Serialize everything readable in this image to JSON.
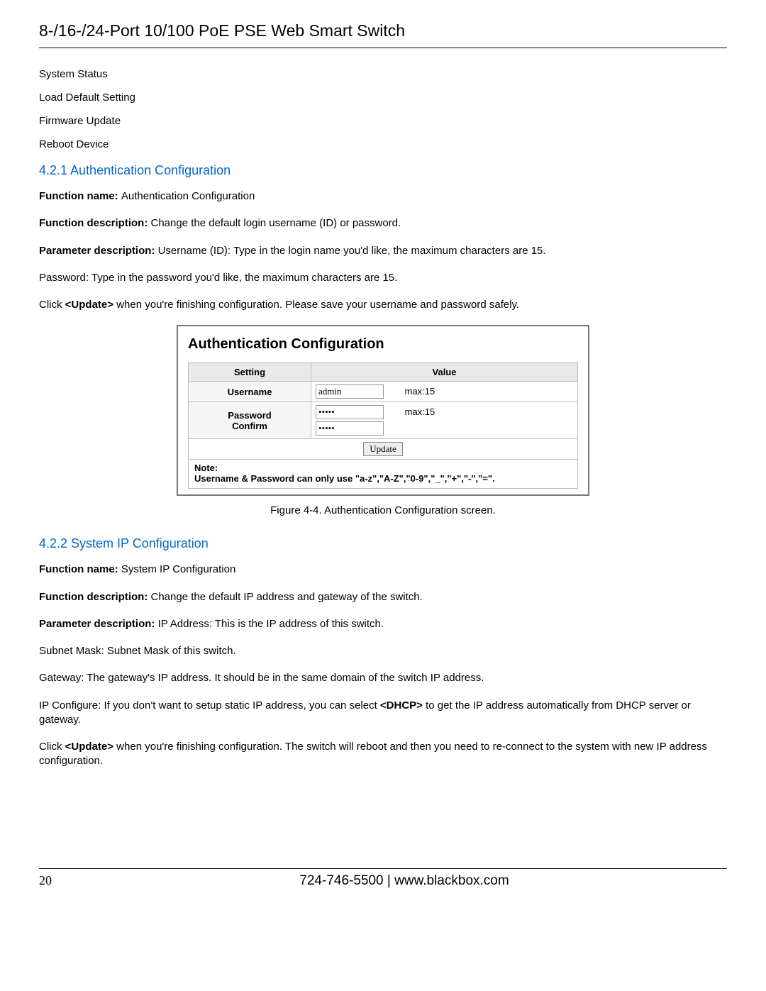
{
  "header": {
    "title": "8-/16-/24-Port 10/100 PoE PSE Web Smart Switch"
  },
  "menu_items": [
    "System Status",
    "Load Default Setting",
    "Firmware Update",
    "Reboot Device"
  ],
  "section1": {
    "heading": "4.2.1 Authentication Configuration",
    "fn_name_label": "Function name: ",
    "fn_name_value": "Authentication Configuration",
    "fn_desc_label": "Function description: ",
    "fn_desc_value": "Change the default login username (ID) or password.",
    "param_label": "Parameter description: ",
    "param_value": "Username (ID): Type in the login name you'd like, the maximum characters are 15.",
    "password_line": "Password: Type in the password you'd like, the maximum characters are 15.",
    "click_prefix": "Click ",
    "update_tag": "<Update>",
    "click_suffix": " when you're finishing configuration. Please save your username and password safely."
  },
  "screenshot": {
    "title": "Authentication Configuration",
    "col_setting": "Setting",
    "col_value": "Value",
    "row_username": "Username",
    "username_value": "admin",
    "max15": "max:15",
    "row_password": "Password",
    "row_confirm": "Confirm",
    "password_value": "•••••",
    "confirm_value": "•••••",
    "update_button": "Update",
    "note_label": "Note:",
    "note_text": "Username & Password can only use \"a-z\",\"A-Z\",\"0-9\",\"_\",\"+\",\"-\",\"=\"."
  },
  "figure_caption": "Figure 4-4. Authentication Configuration screen.",
  "section2": {
    "heading": "4.2.2 System IP Configuration",
    "fn_name_label": "Function name: ",
    "fn_name_value": "System IP Configuration",
    "fn_desc_label": "Function description: ",
    "fn_desc_value": "Change the default IP address and gateway of the switch.",
    "param_label": "Parameter description: ",
    "param_value": "IP Address: This is the IP address of this switch.",
    "subnet_line": "Subnet Mask: Subnet Mask of this switch.",
    "gateway_line": "Gateway: The gateway's IP address. It should be in the same domain of the switch IP address.",
    "ipconf_prefix": "IP Configure: If you don't want to setup static IP address, you can select ",
    "dhcp_tag": "<DHCP>",
    "ipconf_suffix": " to get the IP address automatically from DHCP server or gateway.",
    "click_prefix": "Click ",
    "update_tag": "<Update>",
    "click_suffix": " when you're finishing configuration. The switch will reboot and then you need to re-connect to the system with new IP address configuration."
  },
  "footer": {
    "page_number": "20",
    "phone": "724-746-5500",
    "separator": "   |   ",
    "url": "www.blackbox.com"
  }
}
